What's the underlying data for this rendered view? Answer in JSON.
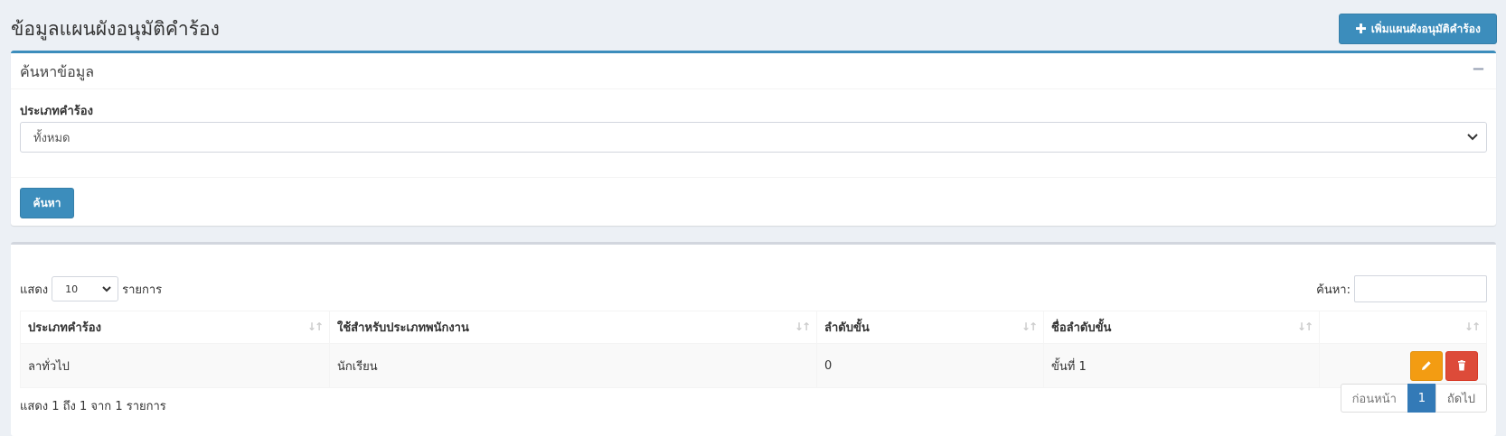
{
  "header": {
    "title": "ข้อมูลแผนผังอนุมัติคำร้อง",
    "add_button_label": "เพิ่มแผนผังอนุมัติคำร้อง",
    "add_icon": "plus-icon"
  },
  "search_box": {
    "title": "ค้นหาข้อมูล",
    "collapse_icon": "minus-icon",
    "field_label": "ประเภทคำร้อง",
    "selected_option": "ทั้งหมด",
    "search_button_label": "ค้นหา"
  },
  "table_box": {
    "show_prefix": "แสดง",
    "page_length": "10",
    "show_suffix": "รายการ",
    "filter_label": "ค้นหา:",
    "columns": [
      "ประเภทคำร้อง",
      "ใช้สำหรับประเภทพนักงาน",
      "ลำดับขั้น",
      "ชื่อลำดับขั้น",
      ""
    ],
    "rows": [
      {
        "type": "ลาทั่วไป",
        "employee_type": "นักเรียน",
        "step": "0",
        "step_name": "ขั้นที่ 1"
      }
    ],
    "info": "แสดง 1 ถึง 1 จาก 1 รายการ",
    "pagination": {
      "prev": "ก่อนหน้า",
      "current": "1",
      "next": "ถัดไป"
    }
  },
  "colors": {
    "primary": "#3c8dbc",
    "warning": "#f39c12",
    "danger": "#dd4b39",
    "background": "#ecf0f5"
  }
}
